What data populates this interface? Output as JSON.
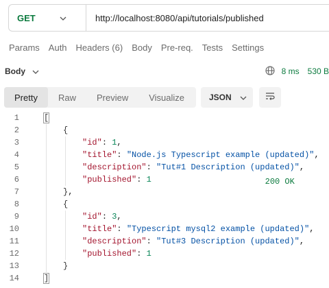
{
  "request": {
    "method": "GET",
    "url": "http://localhost:8080/api/tutorials/published",
    "tabs": [
      "Params",
      "Auth",
      "Headers (6)",
      "Body",
      "Pre-req.",
      "Tests",
      "Settings"
    ]
  },
  "response": {
    "body_label": "Body",
    "status": "200 OK",
    "time": "8 ms",
    "size": "530 B",
    "view_tabs": [
      "Pretty",
      "Raw",
      "Preview",
      "Visualize"
    ],
    "active_view": "Pretty",
    "format": "JSON"
  },
  "icons": [
    "chevron-down-icon",
    "globe-icon",
    "wrap-lines-icon"
  ],
  "colors": {
    "method": "#0b7a3e",
    "status": "#0b7a3e",
    "json_key": "#a3152e",
    "json_string": "#0451a5",
    "json_number": "#098658"
  },
  "code_lines": [
    {
      "n": "1",
      "indent": 0,
      "tokens": [
        [
          "br",
          "["
        ]
      ]
    },
    {
      "n": "2",
      "indent": 1,
      "tokens": [
        [
          "br",
          "{"
        ]
      ]
    },
    {
      "n": "3",
      "indent": 2,
      "tokens": [
        [
          "k",
          "\"id\""
        ],
        [
          "p",
          ": "
        ],
        [
          "n",
          "1"
        ],
        [
          "p",
          ","
        ]
      ]
    },
    {
      "n": "4",
      "indent": 2,
      "tokens": [
        [
          "k",
          "\"title\""
        ],
        [
          "p",
          ": "
        ],
        [
          "s",
          "\"Node.js Typescript example (updated)\""
        ],
        [
          "p",
          ","
        ]
      ]
    },
    {
      "n": "5",
      "indent": 2,
      "tokens": [
        [
          "k",
          "\"description\""
        ],
        [
          "p",
          ": "
        ],
        [
          "s",
          "\"Tut#1 Description (updated)\""
        ],
        [
          "p",
          ","
        ]
      ]
    },
    {
      "n": "6",
      "indent": 2,
      "tokens": [
        [
          "k",
          "\"published\""
        ],
        [
          "p",
          ": "
        ],
        [
          "n",
          "1"
        ]
      ]
    },
    {
      "n": "7",
      "indent": 1,
      "tokens": [
        [
          "br",
          "}"
        ],
        [
          "p",
          ","
        ]
      ]
    },
    {
      "n": "8",
      "indent": 1,
      "tokens": [
        [
          "br",
          "{"
        ]
      ]
    },
    {
      "n": "9",
      "indent": 2,
      "tokens": [
        [
          "k",
          "\"id\""
        ],
        [
          "p",
          ": "
        ],
        [
          "n",
          "3"
        ],
        [
          "p",
          ","
        ]
      ]
    },
    {
      "n": "10",
      "indent": 2,
      "tokens": [
        [
          "k",
          "\"title\""
        ],
        [
          "p",
          ": "
        ],
        [
          "s",
          "\"Typescript mysql2 example (updated)\""
        ],
        [
          "p",
          ","
        ]
      ]
    },
    {
      "n": "11",
      "indent": 2,
      "tokens": [
        [
          "k",
          "\"description\""
        ],
        [
          "p",
          ": "
        ],
        [
          "s",
          "\"Tut#3 Description (updated)\""
        ],
        [
          "p",
          ","
        ]
      ]
    },
    {
      "n": "12",
      "indent": 2,
      "tokens": [
        [
          "k",
          "\"published\""
        ],
        [
          "p",
          ": "
        ],
        [
          "n",
          "1"
        ]
      ]
    },
    {
      "n": "13",
      "indent": 1,
      "tokens": [
        [
          "br",
          "}"
        ]
      ]
    },
    {
      "n": "14",
      "indent": 0,
      "tokens": [
        [
          "br",
          "]"
        ]
      ]
    }
  ]
}
